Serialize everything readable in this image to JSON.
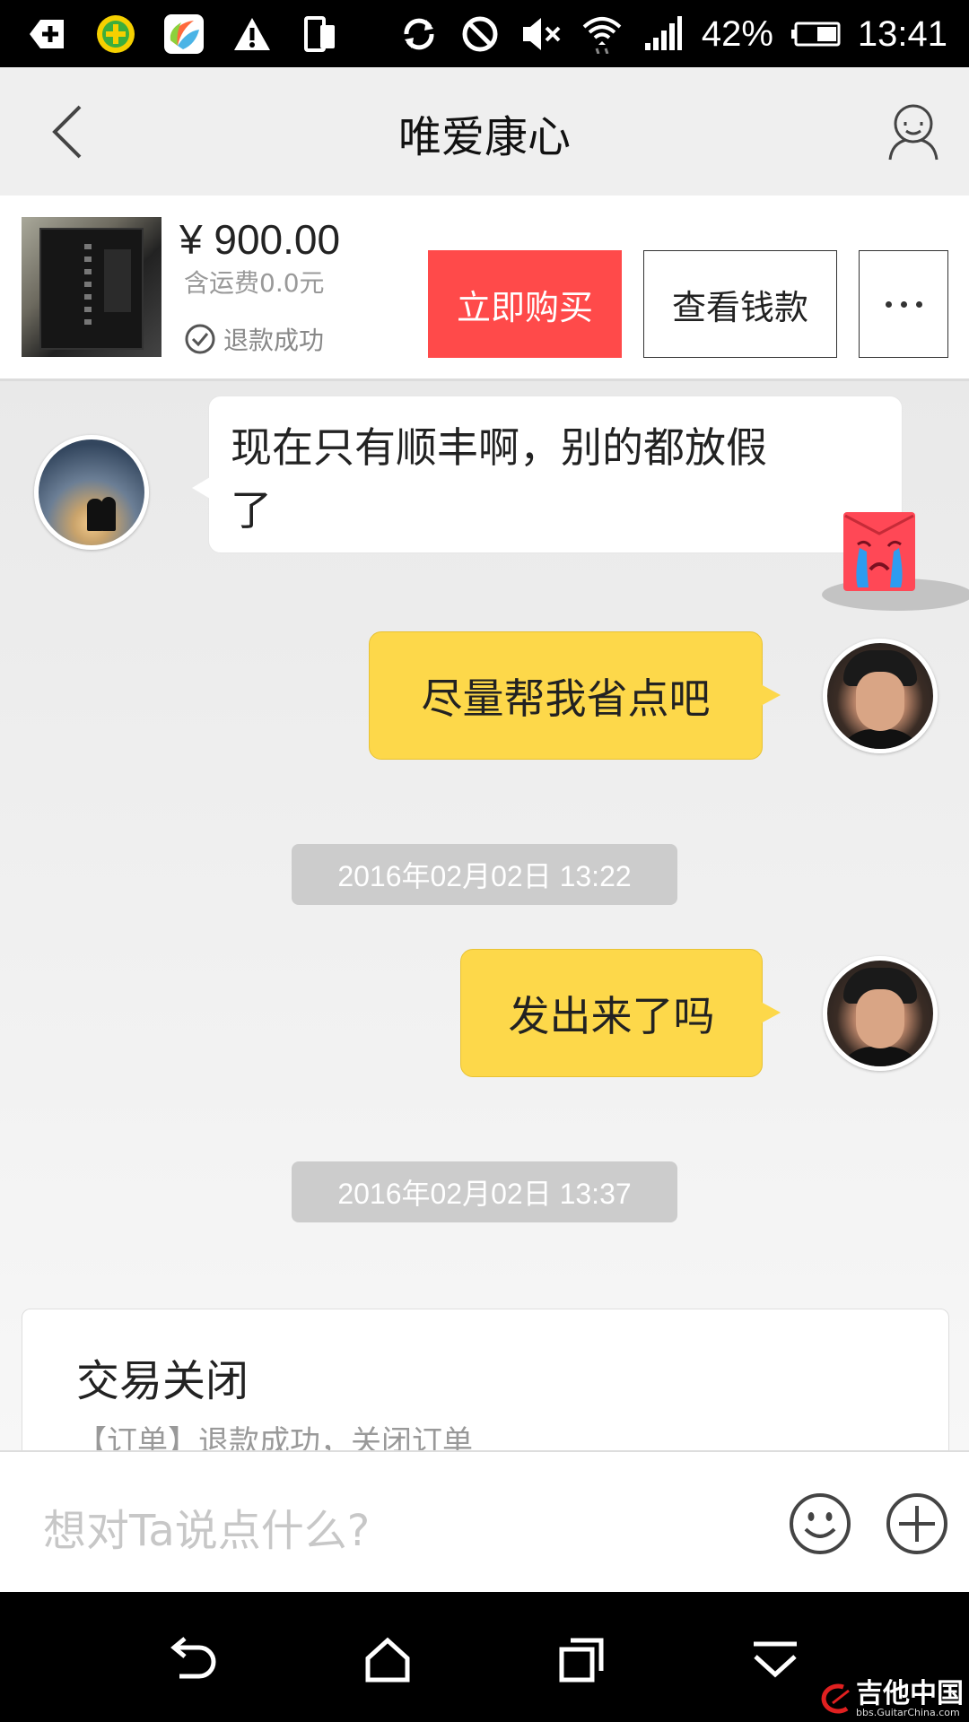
{
  "status_bar": {
    "battery_percent": "42%",
    "time": "13:41",
    "left_icons": [
      "plus-box-icon",
      "security-app-icon",
      "colorful-app-icon",
      "warning-icon",
      "screen-rotate-icon"
    ],
    "right_icons": [
      "sync-icon",
      "blocked-icon",
      "mute-icon",
      "wifi-icon",
      "signal-icon",
      "battery-icon"
    ]
  },
  "header": {
    "title": "唯爱康心"
  },
  "product": {
    "price": "¥ 900.00",
    "shipping": "含运费0.0元",
    "status": "退款成功",
    "buy_button": "立即购买",
    "view_button": "查看钱款"
  },
  "messages": [
    {
      "side": "left",
      "text_line1": "现在只有顺丰啊，别的都放假",
      "text_line2": "了"
    },
    {
      "side": "right",
      "text": "尽量帮我省点吧"
    },
    {
      "timestamp": "2016年02月02日 13:22"
    },
    {
      "side": "right",
      "text": "发出来了吗"
    },
    {
      "timestamp": "2016年02月02日 13:37"
    }
  ],
  "order_card": {
    "title": "交易关闭",
    "subtitle": "【订单】退款成功，关闭订单"
  },
  "input": {
    "placeholder": "想对Ta说点什么?"
  },
  "watermark": {
    "text": "吉他中国",
    "url": "bbs.GuitarChina.com"
  },
  "colors": {
    "buy_button": "#ff4a4a",
    "my_bubble": "#fdd84a",
    "timestamp_bg": "#cccccc"
  }
}
